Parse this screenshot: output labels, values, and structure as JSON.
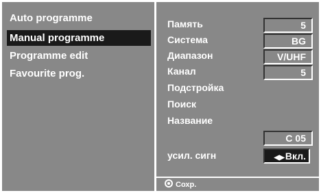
{
  "menu": {
    "items": [
      {
        "label": "Auto programme",
        "selected": false
      },
      {
        "label": "Manual programme",
        "selected": true
      },
      {
        "label": "Programme edit",
        "selected": false
      },
      {
        "label": "Favourite prog.",
        "selected": false
      }
    ]
  },
  "settings": {
    "memory": {
      "label": "Память",
      "value": "5"
    },
    "system": {
      "label": "Система",
      "value": "BG"
    },
    "band": {
      "label": "Диапазон",
      "value": "V/UHF"
    },
    "channel": {
      "label": "Канал",
      "value": "5"
    },
    "fine_tune": {
      "label": "Подстройка"
    },
    "search": {
      "label": "Поиск"
    },
    "name": {
      "label": "Название",
      "value": "C 05"
    },
    "booster": {
      "label": "усил. сигн",
      "value": "Вкл.",
      "icon": "left-right-arrows-icon"
    }
  },
  "footer": {
    "label": "Сохр.",
    "icon": "ok-button-icon"
  },
  "colors": {
    "panel": "#888888",
    "selected": "#1a1a1a",
    "text": "#ffffff"
  }
}
